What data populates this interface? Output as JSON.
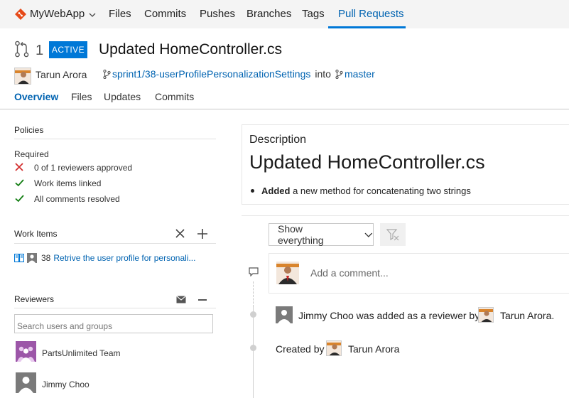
{
  "app": {
    "repo_name": "MyWebApp",
    "repo_icon": "git-diamond-icon",
    "accent_color": "#0078d7",
    "nav_tabs": [
      {
        "label": "Files"
      },
      {
        "label": "Commits"
      },
      {
        "label": "Pushes"
      },
      {
        "label": "Branches"
      },
      {
        "label": "Tags"
      },
      {
        "label": "Pull Requests",
        "active": true
      }
    ]
  },
  "pr": {
    "number": "1",
    "status": "ACTIVE",
    "title": "Updated HomeController.cs",
    "author": "Tarun Arora",
    "source_branch": "sprint1/38-userProfilePersonalizationSettings",
    "into_text": "into",
    "target_branch": "master",
    "subtabs": [
      {
        "label": "Overview",
        "active": true
      },
      {
        "label": "Files"
      },
      {
        "label": "Updates"
      },
      {
        "label": "Commits"
      }
    ]
  },
  "policies": {
    "heading": "Policies",
    "required_label": "Required",
    "items": [
      {
        "text": "0 of 1 reviewers approved",
        "status": "fail",
        "icon": "x-icon"
      },
      {
        "text": "Work items linked",
        "status": "ok",
        "icon": "check-icon"
      },
      {
        "text": "All comments resolved",
        "status": "ok",
        "icon": "check-icon"
      }
    ]
  },
  "work_items": {
    "heading": "Work Items",
    "items": [
      {
        "id": "38",
        "title": "Retrive the user profile for personali..."
      }
    ]
  },
  "reviewers": {
    "heading": "Reviewers",
    "search_placeholder": "Search users and groups",
    "items": [
      {
        "name": "PartsUnlimited Team",
        "avatar": "team-avatar-icon"
      },
      {
        "name": "Jimmy Choo",
        "avatar": "user-placeholder-icon"
      }
    ]
  },
  "description": {
    "label": "Description",
    "heading": "Updated HomeController.cs",
    "bullet_bold": "Added",
    "bullet_rest": "a new method for concatenating two strings"
  },
  "activity": {
    "filter_label": "Show everything",
    "comment_placeholder": "Add a comment...",
    "events": [
      {
        "text": "Jimmy Choo was added as a reviewer by",
        "actor": "Tarun Arora."
      },
      {
        "text": "Created by",
        "actor": "Tarun Arora"
      }
    ]
  }
}
